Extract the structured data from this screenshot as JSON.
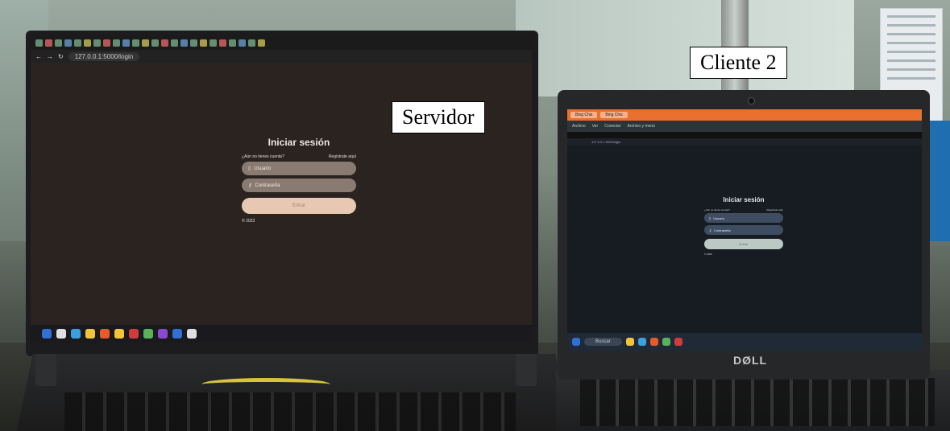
{
  "labels": {
    "server": "Servidor",
    "client": "Cliente 2"
  },
  "server_screen": {
    "url": "127.0.0.1:5000/login",
    "login": {
      "title": "Iniciar sesión",
      "no_account_text": "¿Aún no tienes cuenta?",
      "register_link": "Regístrate aquí",
      "username_placeholder": "Usuario",
      "password_placeholder": "Contraseña",
      "submit_label": "Entrar",
      "footer": "© 2023"
    }
  },
  "client_screen": {
    "tab_label": "Bing Chis",
    "rdp_menu": [
      "Archivo",
      "Ver",
      "Conectar",
      "Archivo y menú"
    ],
    "url": "127.0.0.1:5000/login",
    "login": {
      "title": "Iniciar sesión",
      "no_account_text": "¿Aún no tienes cuenta?",
      "register_link": "Regístrate aquí",
      "username_placeholder": "Usuario",
      "password_placeholder": "Contraseña",
      "submit_label": "Entrar",
      "footer": "© 2023"
    },
    "search_placeholder": "Buscar",
    "brand": "DØLL"
  },
  "colors": {
    "taskbar_icons": [
      "#2f6fd6",
      "#e85a2a",
      "#f3c43a",
      "#d23b3b",
      "#3aa0e0",
      "#59b25a",
      "#8a4ad0",
      "#e0e0e0"
    ]
  }
}
